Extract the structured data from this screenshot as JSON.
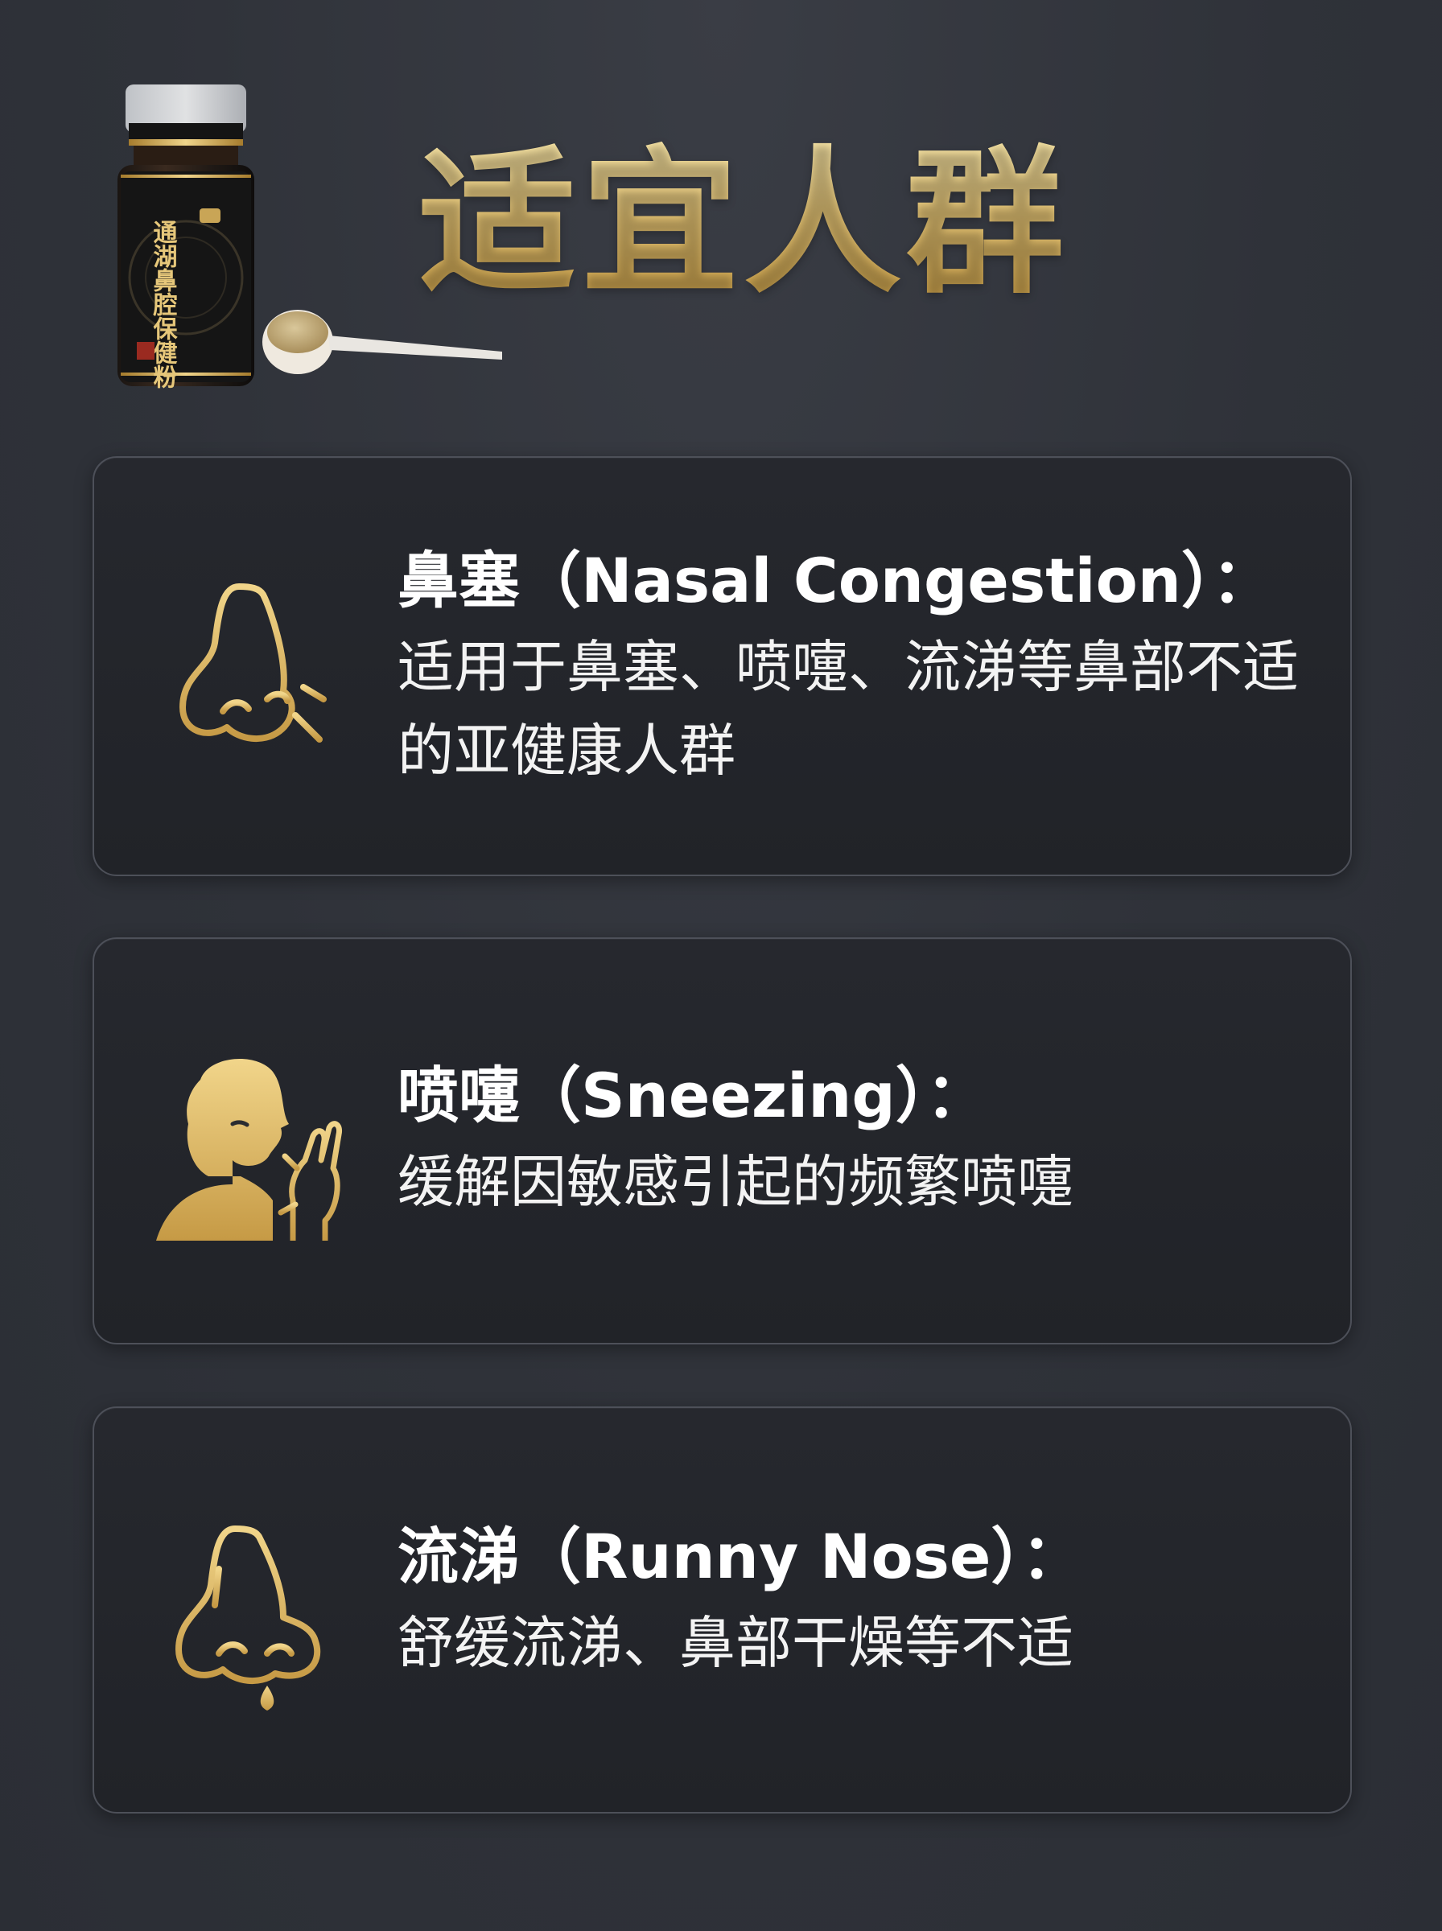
{
  "page": {
    "title": "适宜人群",
    "background_color": "#2f3239",
    "accent_color": "#d9b45f"
  },
  "product": {
    "label_text": "通湖鼻腔保健粉",
    "icon": "product-bottle-with-scoop"
  },
  "groups": [
    {
      "heading": "鼻塞（Nasal Congestion）：",
      "description": "适用于鼻塞、喷嚏、流涕等鼻部不适的亚健康人群",
      "icon": "nose-congestion-icon"
    },
    {
      "heading": "喷嚏（Sneezing）：",
      "description": "缓解因敏感引起的频繁喷嚏",
      "icon": "sneezing-person-icon"
    },
    {
      "heading": "流涕（Runny Nose）：",
      "description": "舒缓流涕、鼻部干燥等不适",
      "icon": "runny-nose-icon"
    }
  ]
}
